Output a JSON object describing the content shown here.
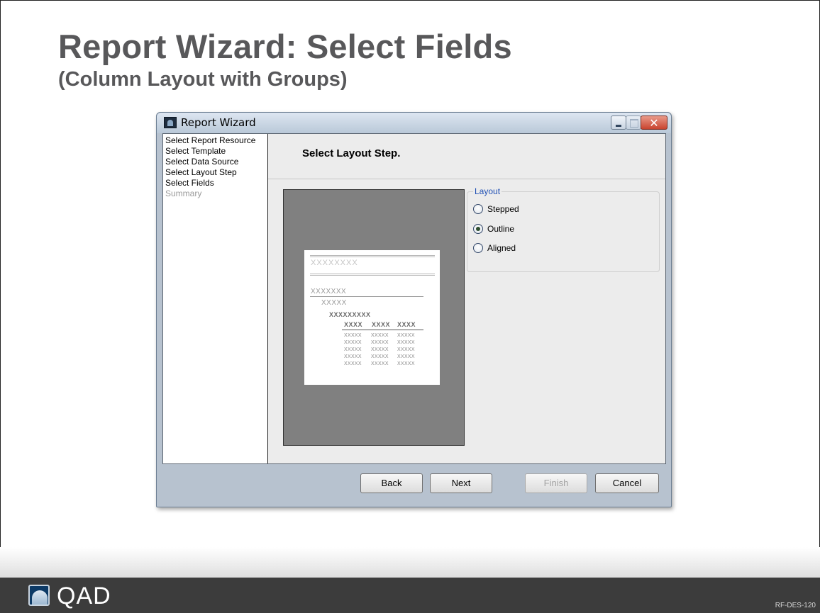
{
  "slide": {
    "title": "Report Wizard: Select Fields",
    "subtitle": "(Column Layout with Groups)"
  },
  "window": {
    "title": "Report Wizard",
    "icon": "report-wizard-app-icon"
  },
  "steps": [
    {
      "label": "Select Report Resource",
      "enabled": true
    },
    {
      "label": "Select Template",
      "enabled": true
    },
    {
      "label": "Select Data Source",
      "enabled": true
    },
    {
      "label": "Select Layout Step",
      "enabled": true
    },
    {
      "label": "Select Fields",
      "enabled": true
    },
    {
      "label": "Summary",
      "enabled": false
    }
  ],
  "main": {
    "heading": "Select Layout Step."
  },
  "preview": {
    "header": "XXXXXXXX",
    "group1": "XXXXXXX",
    "group2": "XXXXX",
    "group3": "XXXXXXXXX",
    "columns": [
      "XXXX",
      "XXXX",
      "XXXX"
    ],
    "row_cells": [
      "XXXXX",
      "XXXXX",
      "XXXXX"
    ],
    "row_count": 5
  },
  "layout": {
    "legend": "Layout",
    "options": [
      {
        "label": "Stepped",
        "selected": false
      },
      {
        "label": "Outline",
        "selected": true
      },
      {
        "label": "Aligned",
        "selected": false
      }
    ]
  },
  "buttons": {
    "back": "Back",
    "next": "Next",
    "finish": "Finish",
    "cancel": "Cancel",
    "finish_enabled": false
  },
  "footer": {
    "brand": "QAD",
    "code": "RF-DES-120"
  },
  "colors": {
    "title_gray": "#58585a",
    "legend_blue": "#1f4fb4",
    "footer_bg": "#3c3c3c",
    "preview_bg": "#808080"
  }
}
